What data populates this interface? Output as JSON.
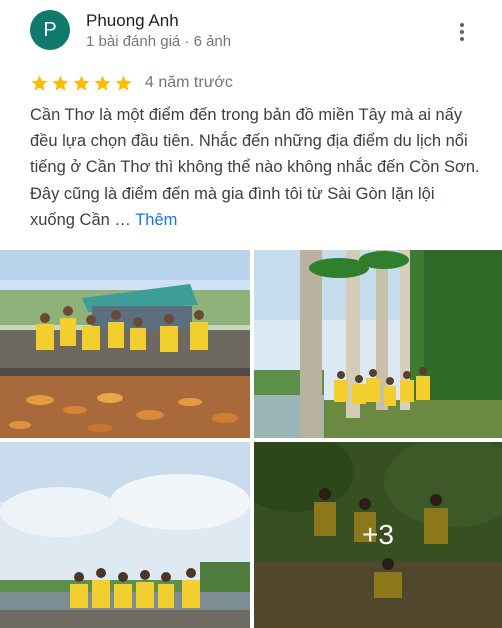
{
  "reviewer": {
    "initial": "P",
    "name": "Phuong Anh",
    "meta": "1 bài đánh giá · 6 ảnh",
    "avatar_color": "#0f7a6b"
  },
  "review": {
    "rating": 5,
    "star_color": "#fbbc04",
    "date": "4 năm trước",
    "text": "Cần Thơ là một điểm đến trong bản đồ miền Tây mà ai nấy đều lựa chọn đầu tiên. Nhắc đến những địa điểm du lịch nổi tiếng ở Cần Thơ thì không thể nào không nhắc đến Cồn Sơn. Đây cũng là điểm đến mà gia đình tôi từ Sài Gòn lặn lội xuống Cần …",
    "more_label": "Thêm"
  },
  "icons": {
    "more": "more-vert-icon",
    "star": "star-icon"
  },
  "photos": {
    "extra_count_label": "+3"
  }
}
